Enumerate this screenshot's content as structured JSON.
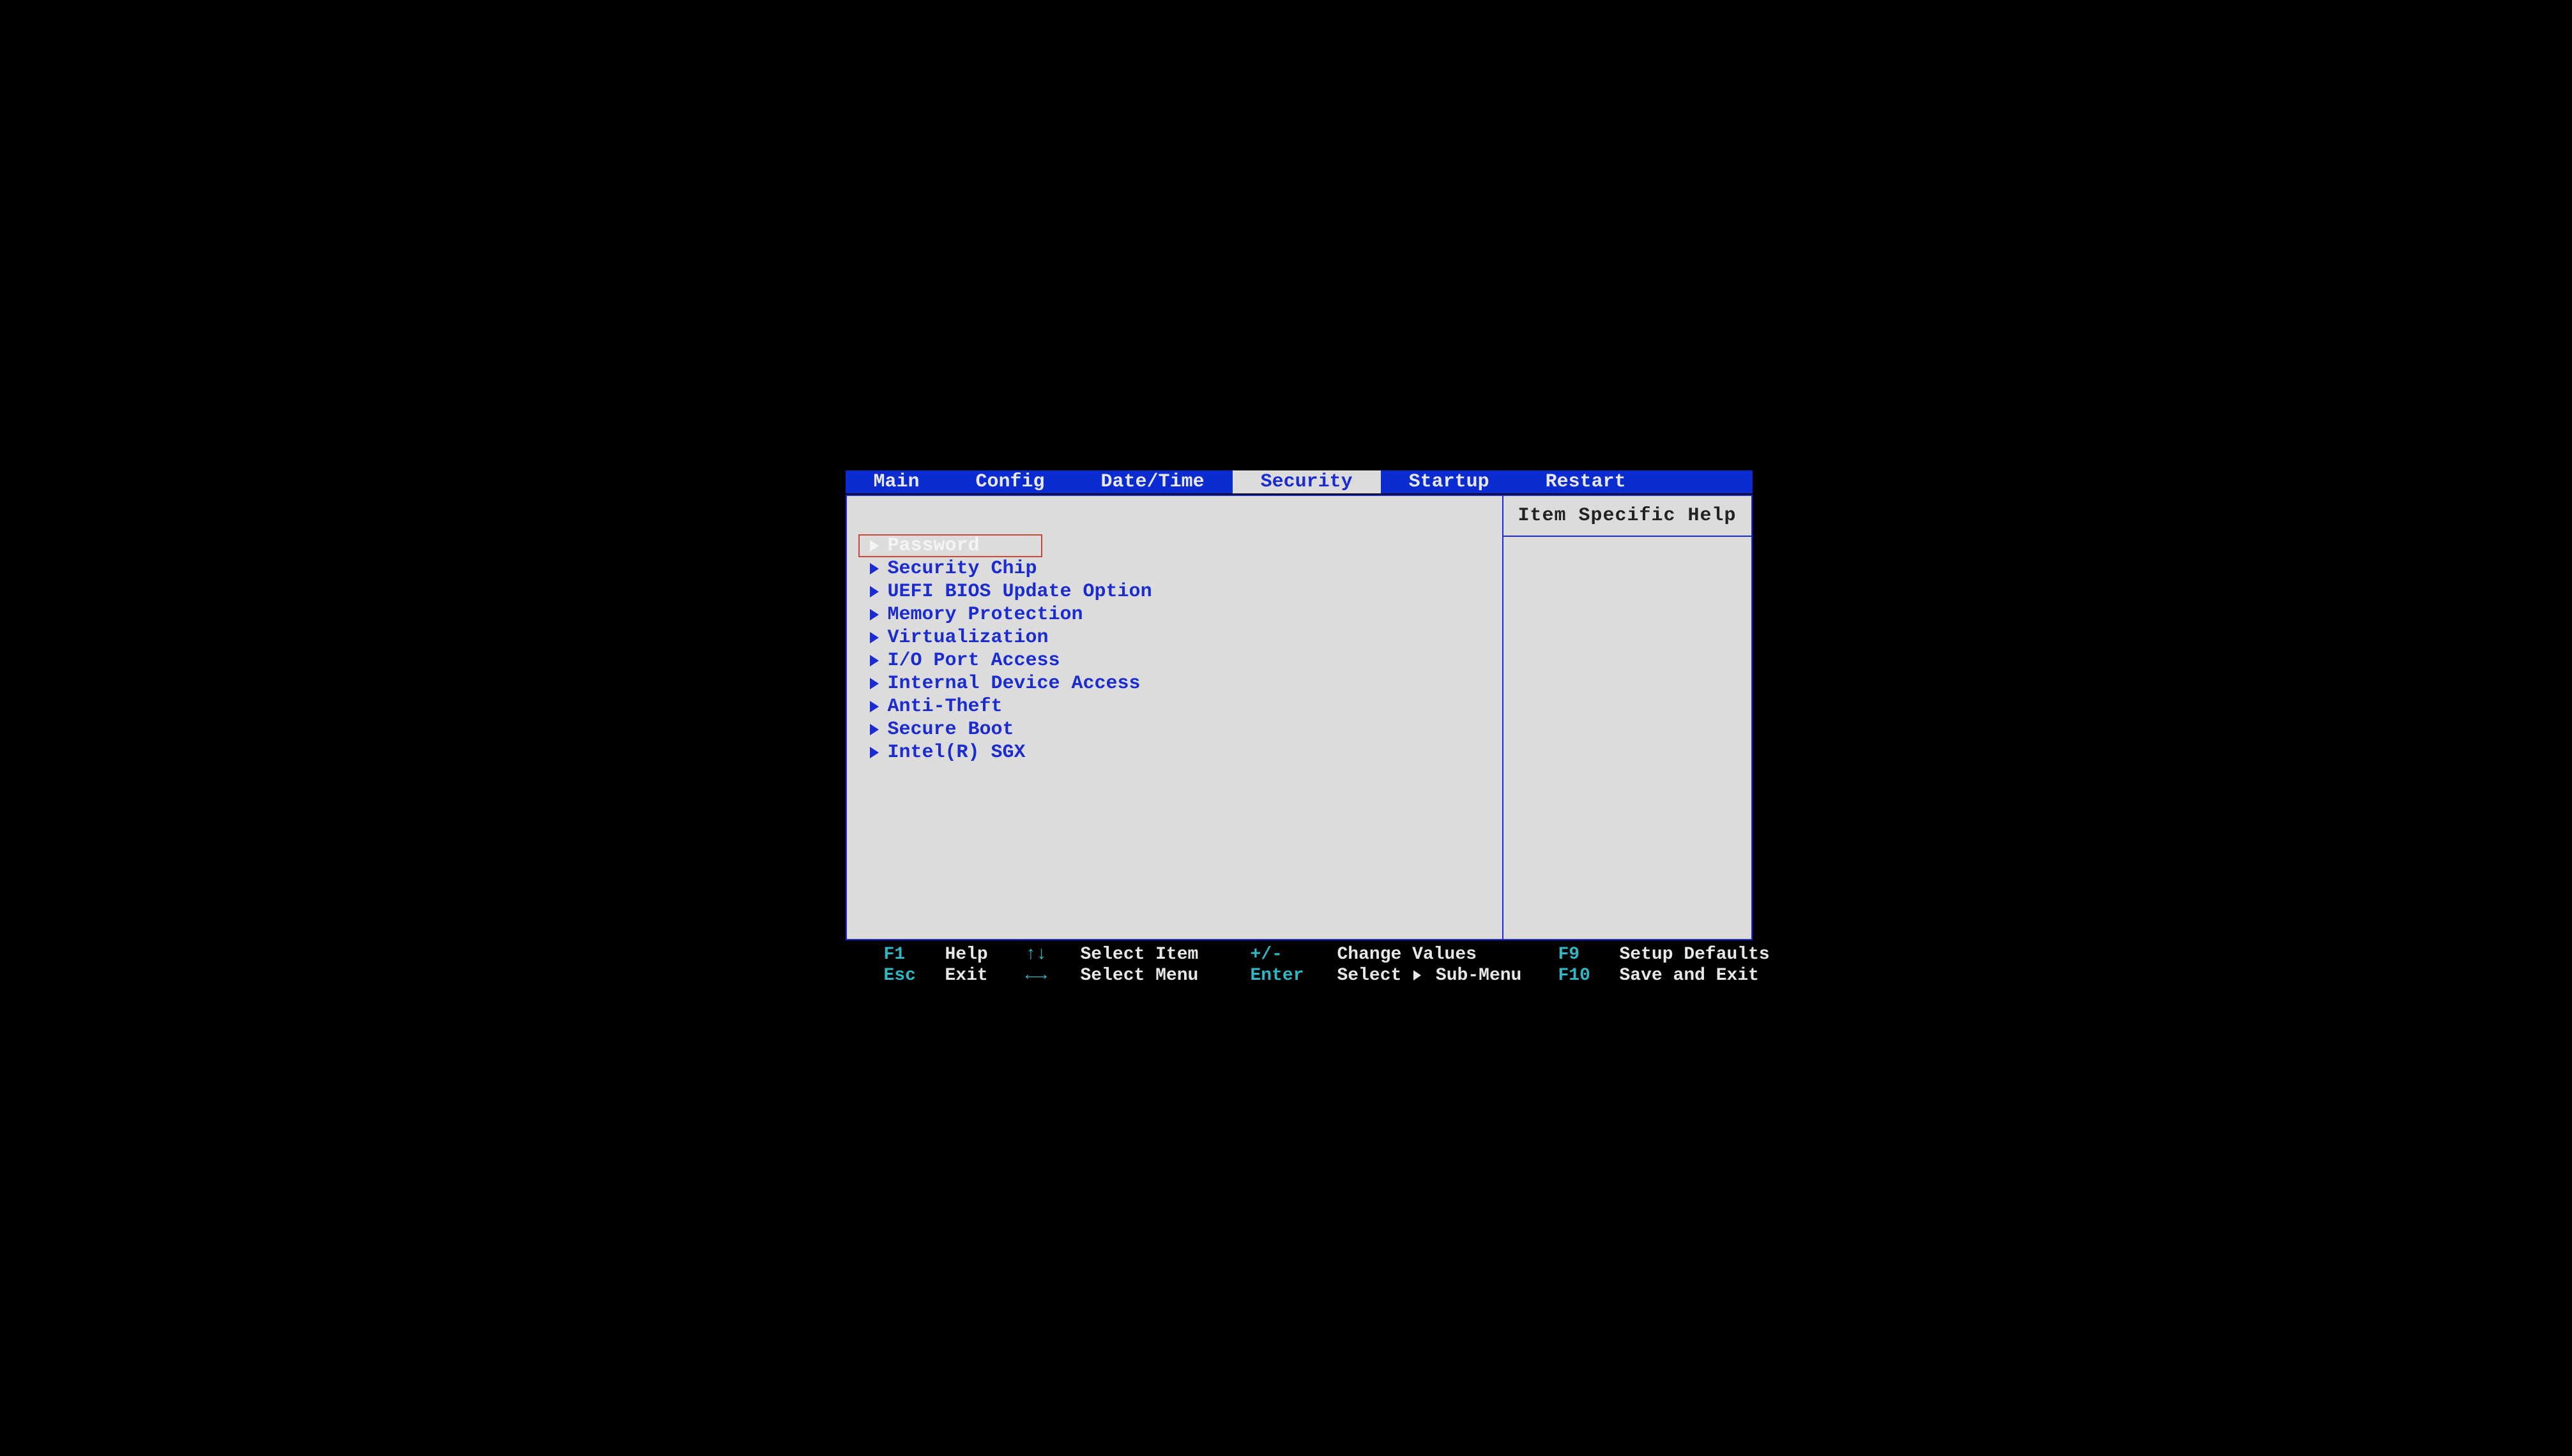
{
  "tabs": {
    "items": [
      {
        "label": "Main",
        "active": false
      },
      {
        "label": "Config",
        "active": false
      },
      {
        "label": "Date/Time",
        "active": false
      },
      {
        "label": "Security",
        "active": true
      },
      {
        "label": "Startup",
        "active": false
      },
      {
        "label": "Restart",
        "active": false
      }
    ]
  },
  "help_panel": {
    "title": "Item Specific Help"
  },
  "menu": {
    "items": [
      {
        "label": "Password",
        "selected": true
      },
      {
        "label": "Security Chip",
        "selected": false
      },
      {
        "label": "UEFI BIOS Update Option",
        "selected": false
      },
      {
        "label": "Memory Protection",
        "selected": false
      },
      {
        "label": "Virtualization",
        "selected": false
      },
      {
        "label": "I/O Port Access",
        "selected": false
      },
      {
        "label": "Internal Device Access",
        "selected": false
      },
      {
        "label": "Anti-Theft",
        "selected": false
      },
      {
        "label": "Secure Boot",
        "selected": false
      },
      {
        "label": "Intel(R) SGX",
        "selected": false
      }
    ]
  },
  "footer": {
    "r1": {
      "k1": "F1",
      "a1": "Help",
      "arr1": "↑↓",
      "a2": "Select Item",
      "k2": "+/-",
      "a3": "Change Values",
      "k3": "F9",
      "a4": "Setup Defaults"
    },
    "r2": {
      "k1": "Esc",
      "a1": "Exit",
      "arr1": "←→",
      "a2": "Select Menu",
      "k2": "Enter",
      "a3_pre": "Select ",
      "a3_post": " Sub-Menu",
      "k3": "F10",
      "a4": "Save and Exit"
    }
  }
}
